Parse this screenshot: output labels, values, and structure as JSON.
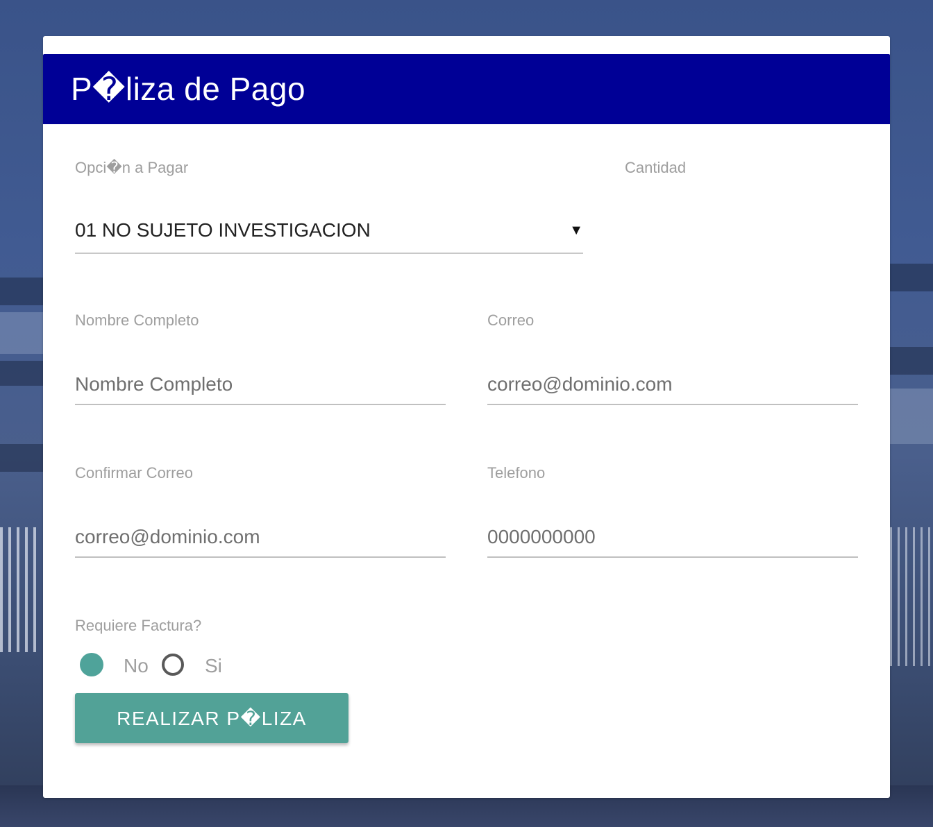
{
  "form": {
    "title": "P�liza de Pago",
    "option_label": "Opci�n a Pagar",
    "option_selected": "01 NO SUJETO INVESTIGACION",
    "quantity_label": "Cantidad",
    "name_label": "Nombre Completo",
    "name_placeholder": "Nombre Completo",
    "email_label": "Correo",
    "email_placeholder": "correo@dominio.com",
    "confirm_email_label": "Confirmar Correo",
    "confirm_email_placeholder": "correo@dominio.com",
    "phone_label": "Telefono",
    "phone_placeholder": "0000000000",
    "invoice_label": "Requiere Factura?",
    "invoice_options": [
      {
        "label": "No",
        "checked": true
      },
      {
        "label": "Si",
        "checked": false
      }
    ],
    "submit_label": "REALIZAR P�LIZA"
  },
  "colors": {
    "header_bg": "#000096",
    "accent": "#52a297"
  }
}
